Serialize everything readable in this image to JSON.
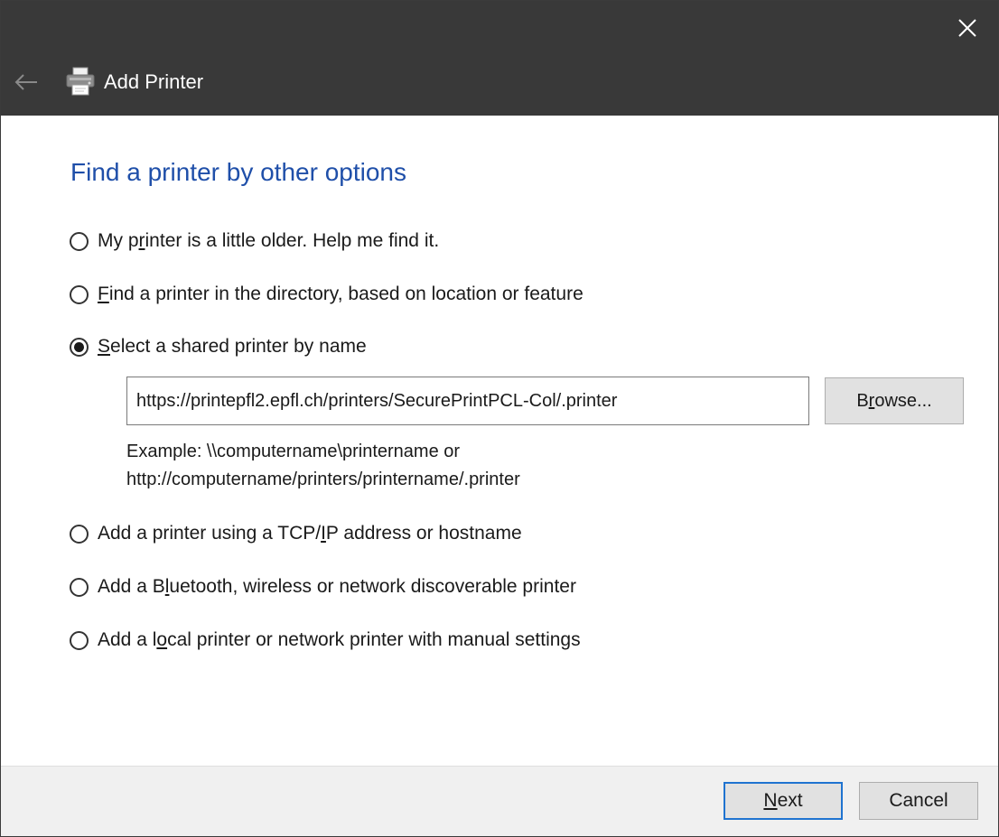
{
  "window": {
    "title": "Add Printer",
    "close_icon": "close-icon",
    "back_icon": "back-arrow-icon",
    "app_icon": "printer-icon"
  },
  "heading": "Find a printer by other options",
  "options": [
    {
      "pre": "My p",
      "key": "r",
      "post": "inter is a little older. Help me find it.",
      "selected": false
    },
    {
      "pre": "",
      "key": "F",
      "post": "ind a printer in the directory, based on location or feature",
      "selected": false
    },
    {
      "pre": "",
      "key": "S",
      "post": "elect a shared printer by name",
      "selected": true
    },
    {
      "pre": "Add a printer using a TCP/",
      "key": "I",
      "post": "P address or hostname",
      "selected": false
    },
    {
      "pre": "Add a B",
      "key": "l",
      "post": "uetooth, wireless or network discoverable printer",
      "selected": false
    },
    {
      "pre": "Add a l",
      "key": "o",
      "post": "cal printer or network printer with manual settings",
      "selected": false
    }
  ],
  "shared_printer": {
    "value": "https://printepfl2.epfl.ch/printers/SecurePrintPCL-Col/.printer",
    "browse": {
      "pre": "B",
      "key": "r",
      "post": "owse..."
    },
    "example_line1": "Example: \\\\computername\\printername or",
    "example_line2": "http://computername/printers/printername/.printer"
  },
  "footer": {
    "next": {
      "pre": "",
      "key": "N",
      "post": "ext"
    },
    "cancel": "Cancel"
  },
  "colors": {
    "titlebar": "#393939",
    "heading": "#1f4fa9",
    "footer": "#f0f0f0",
    "default_button_border": "#1f73d0"
  }
}
